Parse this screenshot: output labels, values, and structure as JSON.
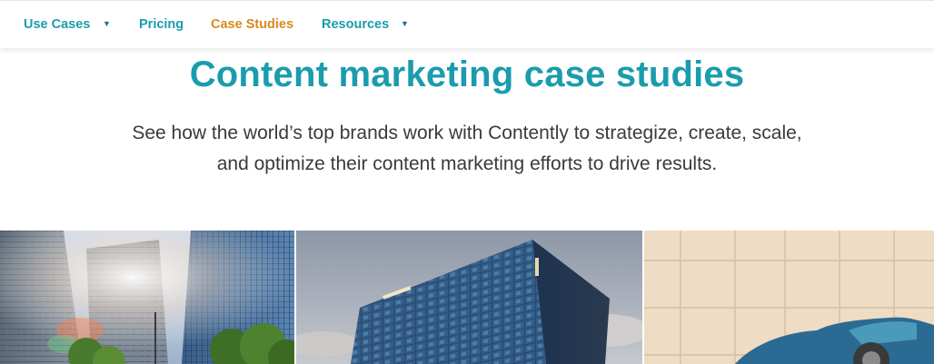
{
  "nav": {
    "items": [
      {
        "label": "Use Cases",
        "has_dropdown": true,
        "active": false
      },
      {
        "label": "Pricing",
        "has_dropdown": false,
        "active": false
      },
      {
        "label": "Case Studies",
        "has_dropdown": false,
        "active": true
      },
      {
        "label": "Resources",
        "has_dropdown": true,
        "active": false
      }
    ],
    "caret_glyph": "▼"
  },
  "hero": {
    "title": "Content marketing case studies",
    "subtitle_line1": "See how the world’s top brands work with Contently to strategize, create, scale,",
    "subtitle_line2": "and optimize their content marketing efforts to drive results."
  },
  "cards": [
    {
      "image": "office-towers-photo"
    },
    {
      "image": "glass-building-photo"
    },
    {
      "image": "illustration-car"
    }
  ],
  "colors": {
    "brand_teal": "#1a9cad",
    "active_orange": "#d88a1e",
    "body_text": "#3a3a3a"
  }
}
